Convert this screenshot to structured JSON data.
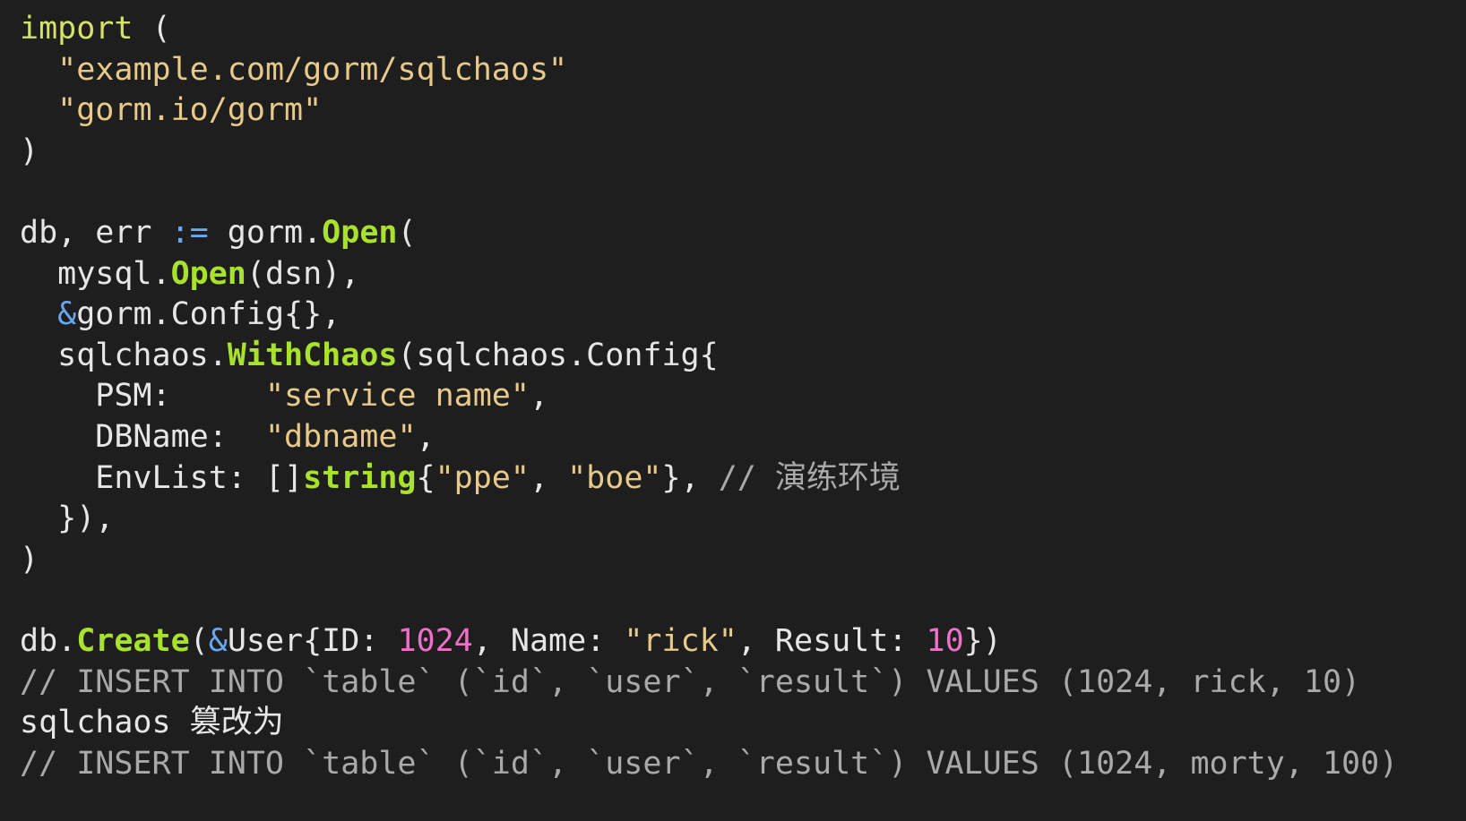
{
  "editor": {
    "lines": [
      [
        {
          "t": "import",
          "k": "kw"
        },
        {
          "t": " (",
          "k": "plain"
        }
      ],
      [
        {
          "t": "  ",
          "k": "plain"
        },
        {
          "t": "\"example.com/gorm/sqlchaos\"",
          "k": "str"
        }
      ],
      [
        {
          "t": "  ",
          "k": "plain"
        },
        {
          "t": "\"gorm.io/gorm\"",
          "k": "str"
        }
      ],
      [
        {
          "t": ")",
          "k": "plain"
        }
      ],
      [],
      [
        {
          "t": "db, err ",
          "k": "plain"
        },
        {
          "t": ":=",
          "k": "op"
        },
        {
          "t": " gorm.",
          "k": "plain"
        },
        {
          "t": "Open",
          "k": "fn"
        },
        {
          "t": "(",
          "k": "plain"
        }
      ],
      [
        {
          "t": "  mysql.",
          "k": "plain"
        },
        {
          "t": "Open",
          "k": "fn"
        },
        {
          "t": "(dsn),",
          "k": "plain"
        }
      ],
      [
        {
          "t": "  ",
          "k": "plain"
        },
        {
          "t": "&",
          "k": "op"
        },
        {
          "t": "gorm.Config{},",
          "k": "plain"
        }
      ],
      [
        {
          "t": "  sqlchaos.",
          "k": "plain"
        },
        {
          "t": "WithChaos",
          "k": "fn"
        },
        {
          "t": "(sqlchaos.Config{",
          "k": "plain"
        }
      ],
      [
        {
          "t": "    PSM:     ",
          "k": "plain"
        },
        {
          "t": "\"service name\"",
          "k": "str"
        },
        {
          "t": ",",
          "k": "plain"
        }
      ],
      [
        {
          "t": "    DBName:  ",
          "k": "plain"
        },
        {
          "t": "\"dbname\"",
          "k": "str"
        },
        {
          "t": ",",
          "k": "plain"
        }
      ],
      [
        {
          "t": "    EnvList: []",
          "k": "plain"
        },
        {
          "t": "string",
          "k": "fn"
        },
        {
          "t": "{",
          "k": "plain"
        },
        {
          "t": "\"ppe\"",
          "k": "str"
        },
        {
          "t": ", ",
          "k": "plain"
        },
        {
          "t": "\"boe\"",
          "k": "str"
        },
        {
          "t": "}, ",
          "k": "plain"
        },
        {
          "t": "// 演练环境",
          "k": "cm"
        }
      ],
      [
        {
          "t": "  }),",
          "k": "plain"
        }
      ],
      [
        {
          "t": ")",
          "k": "plain"
        }
      ],
      [],
      [
        {
          "t": "db.",
          "k": "plain"
        },
        {
          "t": "Create",
          "k": "fn"
        },
        {
          "t": "(",
          "k": "plain"
        },
        {
          "t": "&",
          "k": "op"
        },
        {
          "t": "User{ID: ",
          "k": "plain"
        },
        {
          "t": "1024",
          "k": "num"
        },
        {
          "t": ", Name: ",
          "k": "plain"
        },
        {
          "t": "\"rick\"",
          "k": "str"
        },
        {
          "t": ", Result: ",
          "k": "plain"
        },
        {
          "t": "10",
          "k": "num"
        },
        {
          "t": "})",
          "k": "plain"
        }
      ],
      [
        {
          "t": "// INSERT INTO `table` (`id`, `user`, `result`) VALUES (1024, rick, 10)",
          "k": "cm"
        }
      ],
      [
        {
          "t": "sqlchaos 篡改为",
          "k": "plain"
        }
      ],
      [
        {
          "t": "// INSERT INTO `table` (`id`, `user`, `result`) VALUES (1024, morty, 100)",
          "k": "cm"
        }
      ]
    ]
  }
}
